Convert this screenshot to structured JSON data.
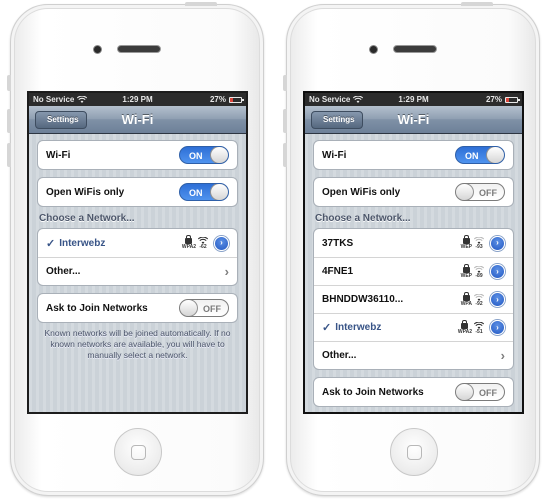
{
  "screens": [
    {
      "status": {
        "carrier": "No Service",
        "time": "1:29 PM",
        "battery": "27%",
        "battery_level": 0.27
      },
      "nav": {
        "back_label": "Settings",
        "title": "Wi-Fi"
      },
      "wifi_row": {
        "label": "Wi-Fi",
        "state": "ON"
      },
      "open_row": {
        "label": "Open WiFis only",
        "state": "ON"
      },
      "choose_header": "Choose a Network...",
      "networks": [
        {
          "name": "Interwebz",
          "security": "WPA2",
          "signal": "-62",
          "selected": true,
          "check": "✓"
        }
      ],
      "other_label": "Other...",
      "ask_row": {
        "label": "Ask to Join Networks",
        "state": "OFF"
      },
      "footnote": "Known networks will be joined automatically. If no known networks are available, you will have to manually select a network."
    },
    {
      "status": {
        "carrier": "No Service",
        "time": "1:29 PM",
        "battery": "27%",
        "battery_level": 0.27
      },
      "nav": {
        "back_label": "Settings",
        "title": "Wi-Fi"
      },
      "wifi_row": {
        "label": "Wi-Fi",
        "state": "ON"
      },
      "open_row": {
        "label": "Open WiFis only",
        "state": "OFF"
      },
      "choose_header": "Choose a Network...",
      "networks": [
        {
          "name": "37TKS",
          "security": "WEP",
          "signal": "-93",
          "selected": false
        },
        {
          "name": "4FNE1",
          "security": "WEP",
          "signal": "-89",
          "selected": false
        },
        {
          "name": "BHNDDW36110...",
          "security": "WPA",
          "signal": "-92",
          "selected": false
        },
        {
          "name": "Interwebz",
          "security": "WPA2",
          "signal": "-51",
          "selected": true,
          "check": "✓"
        }
      ],
      "other_label": "Other...",
      "ask_row": {
        "label": "Ask to Join Networks",
        "state": "OFF"
      }
    }
  ],
  "colors": {
    "toggle_on": "#2e6fd6",
    "selected_text": "#385487",
    "navbar": "#7f91a6"
  }
}
